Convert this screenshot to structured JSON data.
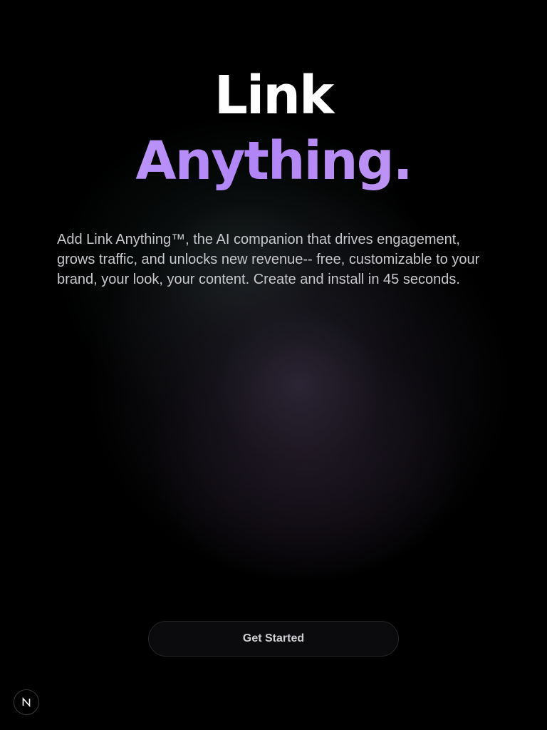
{
  "hero": {
    "title_line1": "Link",
    "title_line2": "Anything."
  },
  "description": "Add Link Anything™, the AI companion that drives engagement, grows traffic, and unlocks new revenue-- free, customizable to your brand, your look, your content. Create and install in 45 seconds.",
  "cta": {
    "label": "Get Started"
  },
  "badge": {
    "icon": "next-n-logo-icon",
    "letter": "N"
  },
  "colors": {
    "background": "#000000",
    "title_primary": "#ffffff",
    "title_accent": "#b98cf8",
    "body_text": "#c8c8cc",
    "button_bg": "#0b0b0d"
  }
}
